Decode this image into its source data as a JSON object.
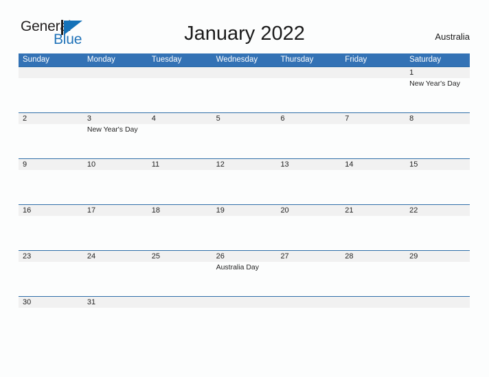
{
  "brand": {
    "name_primary": "General",
    "name_secondary": "Blue",
    "mark": "triangle-logo-icon"
  },
  "header": {
    "title": "January 2022",
    "locale": "Australia"
  },
  "calendar": {
    "month": "January",
    "year": "2022",
    "country": "Australia",
    "weekdays": [
      "Sunday",
      "Monday",
      "Tuesday",
      "Wednesday",
      "Thursday",
      "Friday",
      "Saturday"
    ],
    "colors": {
      "header_blue": "#3372b5",
      "row_rule_blue": "#2e6da8",
      "number_strip_gray": "#f1f1f1",
      "page_background": "#fcfdfd",
      "brand_blue": "#1572b8"
    },
    "weeks": [
      {
        "days": [
          {
            "date": "",
            "event": ""
          },
          {
            "date": "",
            "event": ""
          },
          {
            "date": "",
            "event": ""
          },
          {
            "date": "",
            "event": ""
          },
          {
            "date": "",
            "event": ""
          },
          {
            "date": "",
            "event": ""
          },
          {
            "date": "1",
            "event": "New Year's Day"
          }
        ]
      },
      {
        "days": [
          {
            "date": "2",
            "event": ""
          },
          {
            "date": "3",
            "event": "New Year's Day"
          },
          {
            "date": "4",
            "event": ""
          },
          {
            "date": "5",
            "event": ""
          },
          {
            "date": "6",
            "event": ""
          },
          {
            "date": "7",
            "event": ""
          },
          {
            "date": "8",
            "event": ""
          }
        ]
      },
      {
        "days": [
          {
            "date": "9",
            "event": ""
          },
          {
            "date": "10",
            "event": ""
          },
          {
            "date": "11",
            "event": ""
          },
          {
            "date": "12",
            "event": ""
          },
          {
            "date": "13",
            "event": ""
          },
          {
            "date": "14",
            "event": ""
          },
          {
            "date": "15",
            "event": ""
          }
        ]
      },
      {
        "days": [
          {
            "date": "16",
            "event": ""
          },
          {
            "date": "17",
            "event": ""
          },
          {
            "date": "18",
            "event": ""
          },
          {
            "date": "19",
            "event": ""
          },
          {
            "date": "20",
            "event": ""
          },
          {
            "date": "21",
            "event": ""
          },
          {
            "date": "22",
            "event": ""
          }
        ]
      },
      {
        "days": [
          {
            "date": "23",
            "event": ""
          },
          {
            "date": "24",
            "event": ""
          },
          {
            "date": "25",
            "event": ""
          },
          {
            "date": "26",
            "event": "Australia Day"
          },
          {
            "date": "27",
            "event": ""
          },
          {
            "date": "28",
            "event": ""
          },
          {
            "date": "29",
            "event": ""
          }
        ]
      },
      {
        "days": [
          {
            "date": "30",
            "event": ""
          },
          {
            "date": "31",
            "event": ""
          },
          {
            "date": "",
            "event": ""
          },
          {
            "date": "",
            "event": ""
          },
          {
            "date": "",
            "event": ""
          },
          {
            "date": "",
            "event": ""
          },
          {
            "date": "",
            "event": ""
          }
        ]
      }
    ]
  }
}
